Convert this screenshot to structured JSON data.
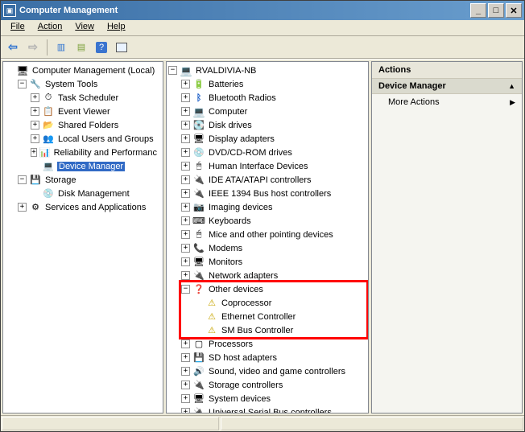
{
  "window": {
    "title": "Computer Management"
  },
  "menu": {
    "file": "File",
    "action": "Action",
    "view": "View",
    "help": "Help"
  },
  "left": {
    "root": "Computer Management (Local)",
    "systools": "System Tools",
    "task": "Task Scheduler",
    "event": "Event Viewer",
    "shared": "Shared Folders",
    "users": "Local Users and Groups",
    "perf": "Reliability and Performanc",
    "devmgr": "Device Manager",
    "storage": "Storage",
    "disk": "Disk Management",
    "services": "Services and Applications"
  },
  "mid": {
    "root": "RVALDIVIA-NB",
    "batteries": "Batteries",
    "bluetooth": "Bluetooth Radios",
    "computer": "Computer",
    "diskdrives": "Disk drives",
    "display": "Display adapters",
    "dvd": "DVD/CD-ROM drives",
    "hid": "Human Interface Devices",
    "ide": "IDE ATA/ATAPI controllers",
    "ieee": "IEEE 1394 Bus host controllers",
    "imaging": "Imaging devices",
    "keyboards": "Keyboards",
    "mice": "Mice and other pointing devices",
    "modems": "Modems",
    "monitors": "Monitors",
    "network": "Network adapters",
    "other": "Other devices",
    "coproc": "Coprocessor",
    "eth": "Ethernet Controller",
    "smbus": "SM Bus Controller",
    "proc": "Processors",
    "sd": "SD host adapters",
    "sound": "Sound, video and game controllers",
    "storctl": "Storage controllers",
    "sysdev": "System devices",
    "usb": "Universal Serial Bus controllers"
  },
  "right": {
    "header": "Actions",
    "section": "Device Manager",
    "more": "More Actions"
  }
}
